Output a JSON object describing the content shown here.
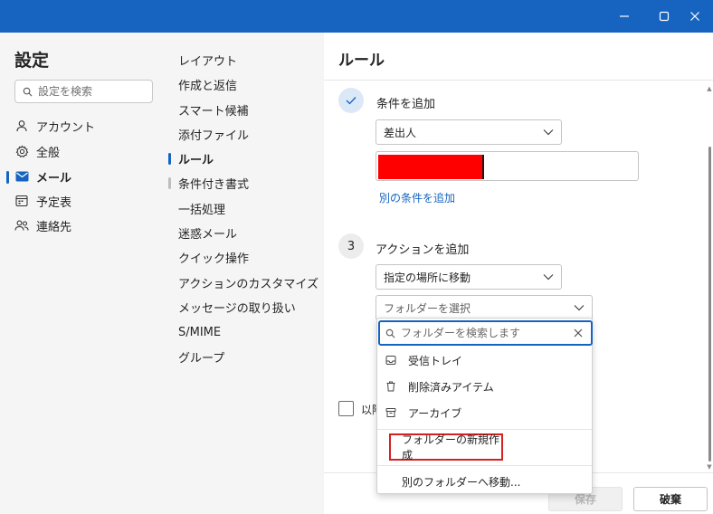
{
  "window": {
    "minimize_icon": "minimize-icon",
    "maximize_icon": "maximize-icon",
    "close_icon": "close-icon"
  },
  "sidebar": {
    "title": "設定",
    "search_placeholder": "設定を検索",
    "items": [
      {
        "label": "アカウント",
        "icon": "person-icon"
      },
      {
        "label": "全般",
        "icon": "gear-icon"
      },
      {
        "label": "メール",
        "icon": "mail-icon",
        "active": true
      },
      {
        "label": "予定表",
        "icon": "calendar-icon"
      },
      {
        "label": "連絡先",
        "icon": "people-icon"
      }
    ]
  },
  "subnav": {
    "items": [
      {
        "label": "レイアウト"
      },
      {
        "label": "作成と返信"
      },
      {
        "label": "スマート候補"
      },
      {
        "label": "添付ファイル"
      },
      {
        "label": "ルール",
        "active": true
      },
      {
        "label": "条件付き書式"
      },
      {
        "label": "一括処理"
      },
      {
        "label": "迷惑メール"
      },
      {
        "label": "クイック操作"
      },
      {
        "label": "アクションのカスタマイズ"
      },
      {
        "label": "メッセージの取り扱い"
      },
      {
        "label": "S/MIME"
      },
      {
        "label": "グループ"
      }
    ]
  },
  "main": {
    "title": "ルール",
    "condition": {
      "step_label": "条件を追加",
      "dropdown_value": "差出人",
      "add_link": "別の条件を追加"
    },
    "action": {
      "step_number": "3",
      "step_label": "アクションを追加",
      "dropdown_value": "指定の場所に移動",
      "folder_placeholder": "フォルダーを選択"
    },
    "checkbox_label": "以降",
    "save_label": "保存",
    "discard_label": "破棄"
  },
  "flyout": {
    "search_placeholder": "フォルダーを検索します",
    "folders": [
      {
        "label": "受信トレイ",
        "icon": "inbox-icon"
      },
      {
        "label": "削除済みアイテム",
        "icon": "trash-icon"
      },
      {
        "label": "アーカイブ",
        "icon": "archive-icon"
      }
    ],
    "new_folder_label": "フォルダーの新規作成",
    "move_other_label": "別のフォルダーへ移動..."
  },
  "colors": {
    "accent": "#1664c0",
    "highlight_border": "#d62020",
    "redaction": "#ff0000"
  }
}
